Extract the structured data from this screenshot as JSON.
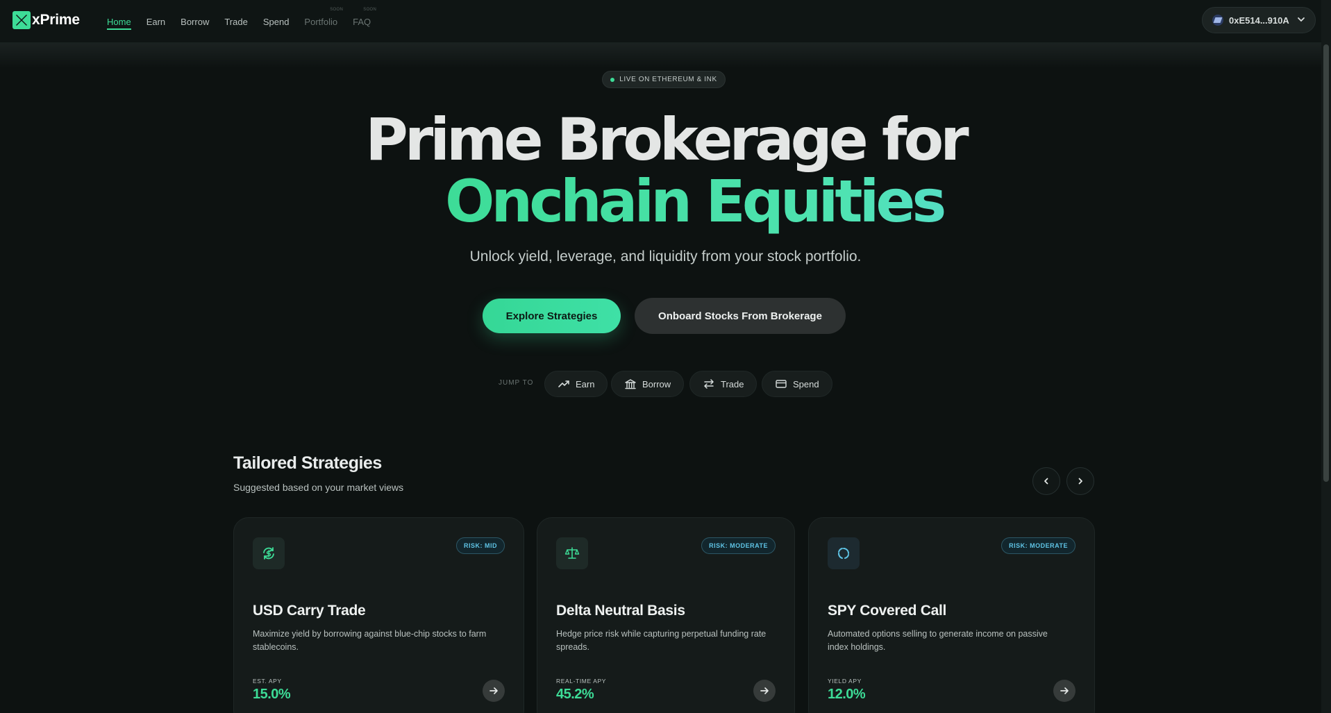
{
  "brand": {
    "name": "xPrime",
    "accent": "#3ddc97"
  },
  "nav": {
    "items": [
      {
        "label": "Home",
        "active": true
      },
      {
        "label": "Earn"
      },
      {
        "label": "Borrow"
      },
      {
        "label": "Trade"
      },
      {
        "label": "Spend"
      },
      {
        "label": "Portfolio",
        "badge": "SOON"
      },
      {
        "label": "FAQ",
        "badge": "SOON"
      }
    ]
  },
  "wallet": {
    "address": "0xE514...910A"
  },
  "hero": {
    "badge": "LIVE ON ETHEREUM & INK",
    "title_line1": "Prime Brokerage for",
    "title_line2": "Onchain Equities",
    "subtitle": "Unlock yield, leverage, and liquidity from your stock portfolio.",
    "primary_cta": "Explore Strategies",
    "secondary_cta": "Onboard Stocks From Brokerage"
  },
  "jump": {
    "label": "JUMP TO",
    "chips": [
      {
        "label": "Earn",
        "icon": "trending-up-icon"
      },
      {
        "label": "Borrow",
        "icon": "bank-icon"
      },
      {
        "label": "Trade",
        "icon": "swap-icon"
      },
      {
        "label": "Spend",
        "icon": "card-icon"
      }
    ]
  },
  "strategies": {
    "title": "Tailored Strategies",
    "subtitle": "Suggested based on your market views",
    "cards": [
      {
        "title": "USD Carry Trade",
        "risk": "RISK: MID",
        "description": "Maximize yield by borrowing against blue-chip stocks to farm stablecoins.",
        "apy_label": "EST. APY",
        "apy": "15.0%",
        "icon": "refresh-dollar-icon"
      },
      {
        "title": "Delta Neutral Basis",
        "risk": "RISK: MODERATE",
        "description": "Hedge price risk while capturing perpetual funding rate spreads.",
        "apy_label": "REAL-TIME APY",
        "apy": "45.2%",
        "icon": "scale-icon"
      },
      {
        "title": "SPY Covered Call",
        "risk": "RISK: MODERATE",
        "description": "Automated options selling to generate income on passive index holdings.",
        "apy_label": "YIELD APY",
        "apy": "12.0%",
        "icon": "loader-icon"
      }
    ]
  }
}
